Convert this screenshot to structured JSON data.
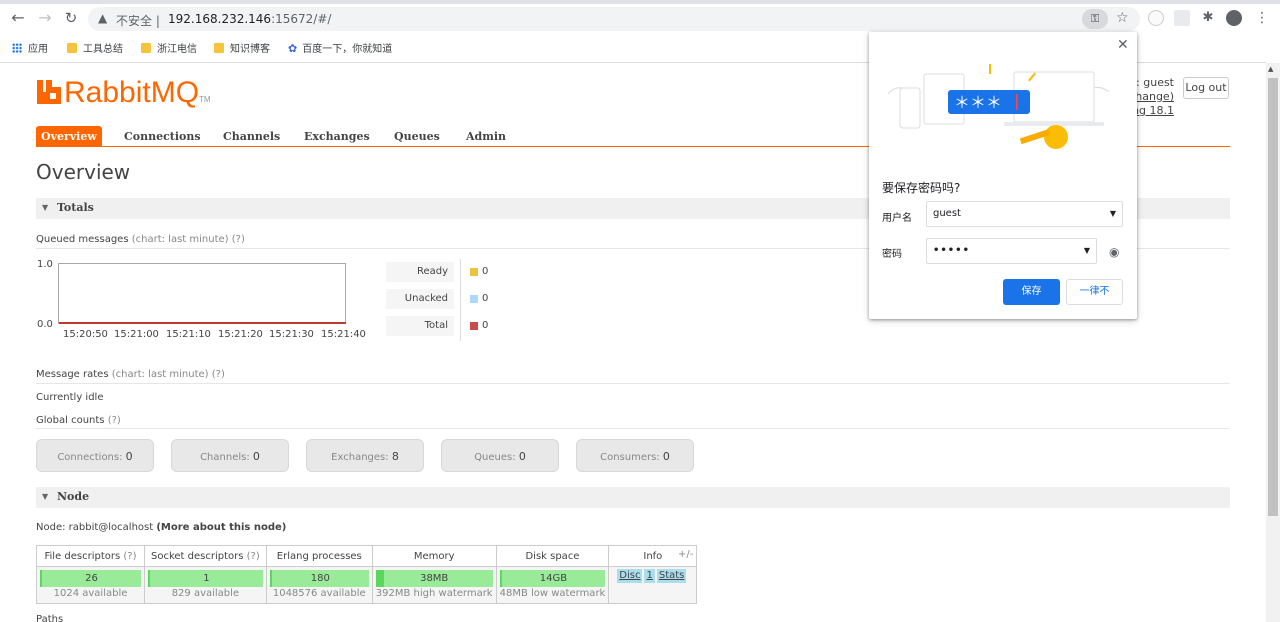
{
  "browser": {
    "url_warning": "不安全",
    "url_host": "192.168.232.146",
    "url_rest": ":15672/#/",
    "bookmarks": [
      "应用",
      "工具总结",
      "浙江电信",
      "知识博客",
      "百度一下，你就知道"
    ]
  },
  "header": {
    "logo": "RabbitMQ",
    "logo_tm": "TM",
    "user_lines": [
      ": guest",
      "change)",
      "ng 18.1"
    ],
    "logout": "Log out"
  },
  "tabs": [
    "Overview",
    "Connections",
    "Channels",
    "Exchanges",
    "Queues",
    "Admin"
  ],
  "page_title": "Overview",
  "totals": {
    "section_title": "Totals",
    "queued_messages_label": "Queued messages",
    "queued_messages_help": "(chart: last minute) (?)",
    "chart_ymax": "1.0",
    "chart_ymin": "0.0",
    "chart_xticks": [
      "15:20:50",
      "15:21:00",
      "15:21:10",
      "15:21:20",
      "15:21:30",
      "15:21:40"
    ],
    "legend": [
      {
        "label": "Ready",
        "value": "0",
        "color": "#edc240"
      },
      {
        "label": "Unacked",
        "value": "0",
        "color": "#afd8f8"
      },
      {
        "label": "Total",
        "value": "0",
        "color": "#cb4b4b"
      }
    ],
    "message_rates_label": "Message rates",
    "message_rates_help": "(chart: last minute) (?)",
    "currently_idle": "Currently idle",
    "global_counts_label": "Global counts",
    "global_counts_help": "(?)",
    "counts": [
      {
        "label": "Connections:",
        "value": "0"
      },
      {
        "label": "Channels:",
        "value": "0"
      },
      {
        "label": "Exchanges:",
        "value": "8"
      },
      {
        "label": "Queues:",
        "value": "0"
      },
      {
        "label": "Consumers:",
        "value": "0"
      }
    ]
  },
  "node": {
    "section_title": "Node",
    "node_prefix": "Node: rabbit@localhost",
    "node_more": "(More about this node)",
    "headers": [
      "File descriptors",
      "Socket descriptors",
      "Erlang processes",
      "Memory",
      "Disk space",
      "Info"
    ],
    "header_help": "(?)",
    "file_descriptors": {
      "value": "26",
      "sub": "1024 available"
    },
    "socket_descriptors": {
      "value": "1",
      "sub": "829 available"
    },
    "erlang_processes": {
      "value": "180",
      "sub": "1048576 available"
    },
    "memory": {
      "value": "38MB",
      "sub": "392MB high watermark"
    },
    "disk_space": {
      "value": "14GB",
      "sub": "48MB low watermark"
    },
    "info_chips": [
      "Disc",
      "1",
      "Stats"
    ],
    "plus_minus": "+/-",
    "paths": "Paths"
  },
  "save_password_popup": {
    "title": "要保存密码吗?",
    "username_label": "用户名",
    "username_value": "guest",
    "password_label": "密码",
    "password_value": "•••••",
    "save_button": "保存",
    "never_button": "一律不"
  },
  "colors": {
    "brand_orange": "#ff6600",
    "google_blue": "#1a73e8",
    "bar_green": "#99eb99"
  }
}
